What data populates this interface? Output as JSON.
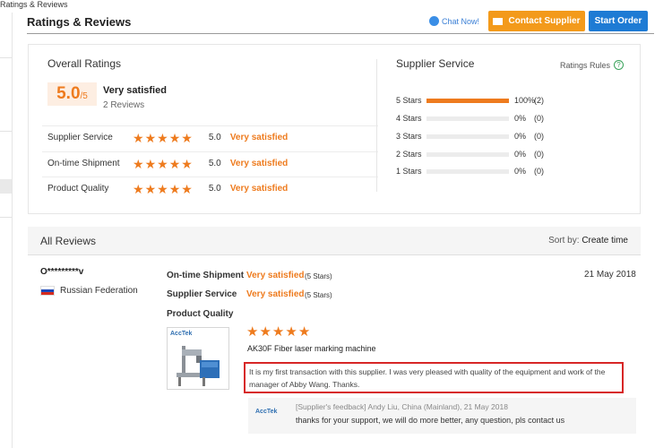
{
  "breadcrumb": "Ratings & Reviews",
  "section_title": "Ratings & Reviews",
  "actions": {
    "chat_label": "Chat Now!",
    "contact_label": "Contact Supplier",
    "order_label": "Start Order"
  },
  "overall": {
    "title": "Overall Ratings",
    "score": "5.0",
    "out_of": "/5",
    "verdict": "Very satisfied",
    "reviews_count": "2 Reviews",
    "categories": [
      {
        "label": "Supplier Service",
        "stars": 5,
        "score": "5.0",
        "verdict": "Very satisfied"
      },
      {
        "label": "On-time Shipment",
        "stars": 5,
        "score": "5.0",
        "verdict": "Very satisfied"
      },
      {
        "label": "Product Quality",
        "stars": 5,
        "score": "5.0",
        "verdict": "Very satisfied"
      }
    ]
  },
  "supplier_service": {
    "title": "Supplier Service",
    "rules_label": "Ratings Rules",
    "distribution": [
      {
        "label": "5 Stars",
        "fraction": 1.0,
        "percent": "100%",
        "count": "(2)"
      },
      {
        "label": "4 Stars",
        "fraction": 0,
        "percent": "0%",
        "count": "(0)"
      },
      {
        "label": "3 Stars",
        "fraction": 0,
        "percent": "0%",
        "count": "(0)"
      },
      {
        "label": "2 Stars",
        "fraction": 0,
        "percent": "0%",
        "count": "(0)"
      },
      {
        "label": "1 Stars",
        "fraction": 0,
        "percent": "0%",
        "count": "(0)"
      }
    ]
  },
  "all_reviews": {
    "title": "All Reviews",
    "sort_label": "Sort by:",
    "sort_value": "Create time"
  },
  "review": {
    "reviewer": "O*********v",
    "country": "Russian Federation",
    "date": "21 May 2018",
    "shipment_label": "On-time Shipment",
    "shipment_value": "Very satisfied",
    "shipment_stars": "(5 Stars)",
    "service_label": "Supplier Service",
    "service_value": "Very satisfied",
    "service_stars": "(5 Stars)",
    "quality_label": "Product Quality",
    "quality_stars": 5,
    "brand": "AccTek",
    "product_name": "AK30F Fiber laser marking machine",
    "comment": "It is my first transaction with this supplier. I was very pleased with quality of the equipment and work of the manager of Abby Wang. Thanks.",
    "feedback_header": "[Supplier's feedback] Andy Liu, China (Mainland), 21 May 2018",
    "feedback_body": "thanks for your support, we will do more better, any question, pls contact us"
  },
  "colors": {
    "accent": "#ee7b1e",
    "contact_button": "#f39a1b",
    "order_button": "#1e7bd4",
    "highlight_border": "#d72626"
  }
}
